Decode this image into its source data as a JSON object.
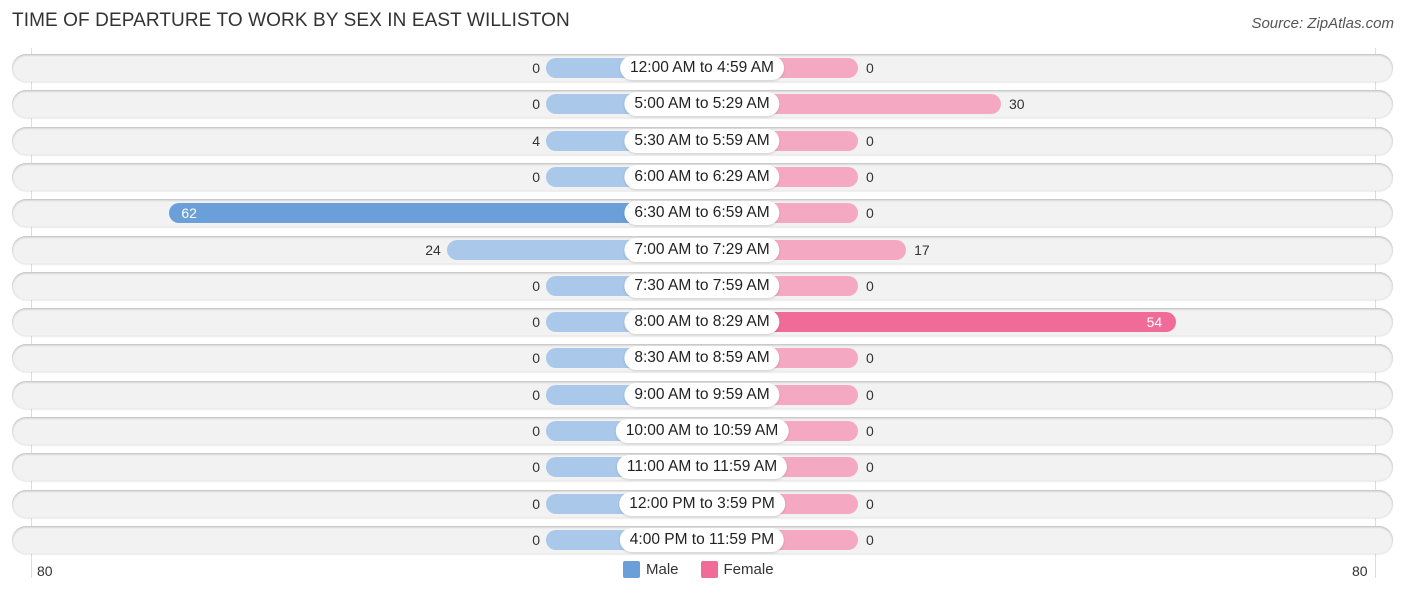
{
  "title": "TIME OF DEPARTURE TO WORK BY SEX IN EAST WILLISTON",
  "source": "Source: ZipAtlas.com",
  "colors": {
    "male": "#a9c8ea",
    "male_strong": "#6a9fda",
    "female": "#f5a8c1",
    "female_strong": "#f06b97"
  },
  "chart_data": {
    "type": "bar",
    "orientation": "horizontal-diverging",
    "title": "TIME OF DEPARTURE TO WORK BY SEX IN EAST WILLISTON",
    "categories": [
      "12:00 AM to 4:59 AM",
      "5:00 AM to 5:29 AM",
      "5:30 AM to 5:59 AM",
      "6:00 AM to 6:29 AM",
      "6:30 AM to 6:59 AM",
      "7:00 AM to 7:29 AM",
      "7:30 AM to 7:59 AM",
      "8:00 AM to 8:29 AM",
      "8:30 AM to 8:59 AM",
      "9:00 AM to 9:59 AM",
      "10:00 AM to 10:59 AM",
      "11:00 AM to 11:59 AM",
      "12:00 PM to 3:59 PM",
      "4:00 PM to 11:59 PM"
    ],
    "series": [
      {
        "name": "Male",
        "values": [
          0,
          0,
          4,
          0,
          62,
          24,
          0,
          0,
          0,
          0,
          0,
          0,
          0,
          0
        ]
      },
      {
        "name": "Female",
        "values": [
          0,
          30,
          0,
          0,
          0,
          17,
          0,
          54,
          0,
          0,
          0,
          0,
          0,
          0
        ]
      }
    ],
    "axis": {
      "left_tick": "80",
      "right_tick": "80",
      "range": [
        0,
        80
      ]
    },
    "legend": {
      "position": "bottom-center",
      "items": [
        "Male",
        "Female"
      ]
    }
  }
}
